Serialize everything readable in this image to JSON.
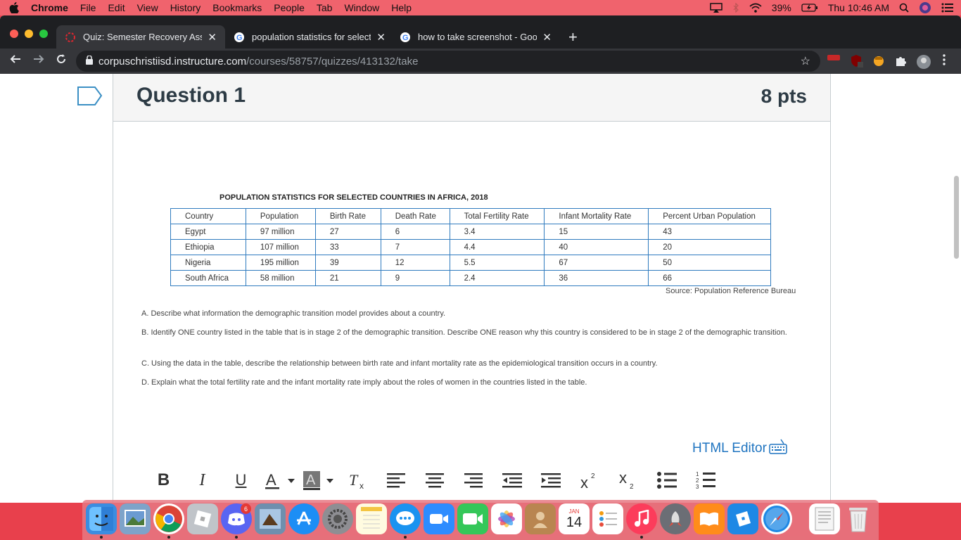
{
  "menubar": {
    "app": "Chrome",
    "items": [
      "File",
      "Edit",
      "View",
      "History",
      "Bookmarks",
      "People",
      "Tab",
      "Window",
      "Help"
    ],
    "battery": "39%",
    "clock": "Thu 10:46 AM"
  },
  "tabs": [
    {
      "title": "Quiz: Semester Recovery Assig",
      "active": true
    },
    {
      "title": "population statistics for selecte",
      "active": false
    },
    {
      "title": "how to take screenshot - Goog",
      "active": false
    }
  ],
  "address": {
    "host": "corpuschristiisd.instructure.com",
    "path": "/courses/58757/quizzes/413132/take"
  },
  "question": {
    "title": "Question 1",
    "points": "8 pts"
  },
  "stats": {
    "title": "POPULATION STATISTICS FOR SELECTED COUNTRIES IN AFRICA, 2018",
    "headers": [
      "Country",
      "Population",
      "Birth Rate",
      "Death Rate",
      "Total Fertility Rate",
      "Infant Mortality Rate",
      "Percent Urban Population"
    ],
    "rows": [
      [
        "Egypt",
        "97 million",
        "27",
        "6",
        "3.4",
        "15",
        "43"
      ],
      [
        "Ethiopia",
        "107 million",
        "33",
        "7",
        "4.4",
        "40",
        "20"
      ],
      [
        "Nigeria",
        "195 million",
        "39",
        "12",
        "5.5",
        "67",
        "50"
      ],
      [
        "South Africa",
        "58 million",
        "21",
        "9",
        "2.4",
        "36",
        "66"
      ]
    ],
    "source": "Source: Population Reference Bureau"
  },
  "prompts": {
    "a": "A. Describe what information the demographic transition model provides about a country.",
    "b": "B. Identify ONE country listed in the table that is in stage 2 of the demographic transition. Describe ONE reason why this country is considered to be in stage 2 of the demographic transition.",
    "c": "C. Using the data in the table, describe the relationship between birth rate and infant mortality rate as the epidemiological transition occurs in a country.",
    "d": "D. Explain what the total fertility rate and the infant mortality rate imply about the roles of women in the countries listed in the table."
  },
  "editor": {
    "html_editor_label": "HTML Editor"
  },
  "dock": {
    "calendar_month": "JAN",
    "calendar_day": "14",
    "discord_badge": "6"
  }
}
